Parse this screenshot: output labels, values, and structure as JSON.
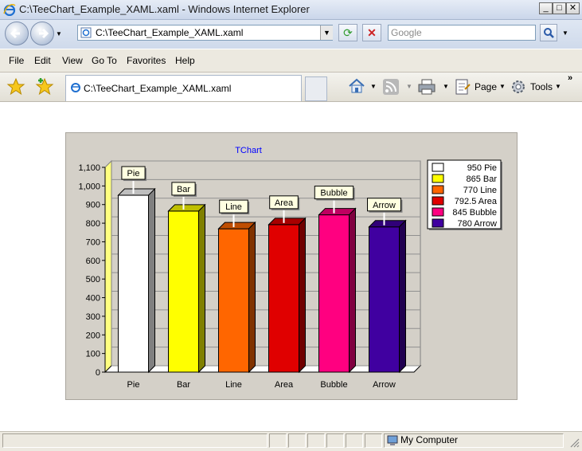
{
  "window": {
    "title": "C:\\TeeChart_Example_XAML.xaml - Windows Internet Explorer",
    "minimize": "_",
    "maximize": "□",
    "close": "✕"
  },
  "address": {
    "url": "C:\\TeeChart_Example_XAML.xaml",
    "search_placeholder": "Google"
  },
  "menu": [
    "File",
    "Edit",
    "View",
    "Go To",
    "Favorites",
    "Help"
  ],
  "tab": {
    "title": "C:\\TeeChart_Example_XAML.xaml"
  },
  "commands": {
    "page": "Page",
    "tools": "Tools"
  },
  "status": {
    "zone": "My Computer"
  },
  "chart_data": {
    "type": "bar",
    "title": "TChart",
    "categories": [
      "Pie",
      "Bar",
      "Line",
      "Area",
      "Bubble",
      "Arrow"
    ],
    "values": [
      950,
      865,
      770,
      792.5,
      845,
      780
    ],
    "colors": [
      "#ffffff",
      "#ffff00",
      "#ff6600",
      "#e00000",
      "#ff0080",
      "#4000a0"
    ],
    "ylim": [
      0,
      1100
    ],
    "yticks": [
      "0",
      "100",
      "200",
      "300",
      "400",
      "500",
      "600",
      "700",
      "800",
      "900",
      "1,000",
      "1,100"
    ],
    "legend": [
      "950 Pie",
      "865 Bar",
      "770 Line",
      "792.5 Area",
      "845 Bubble",
      "780 Arrow"
    ],
    "legend_position": "right",
    "grid": true,
    "title_color": "#0000ff"
  }
}
